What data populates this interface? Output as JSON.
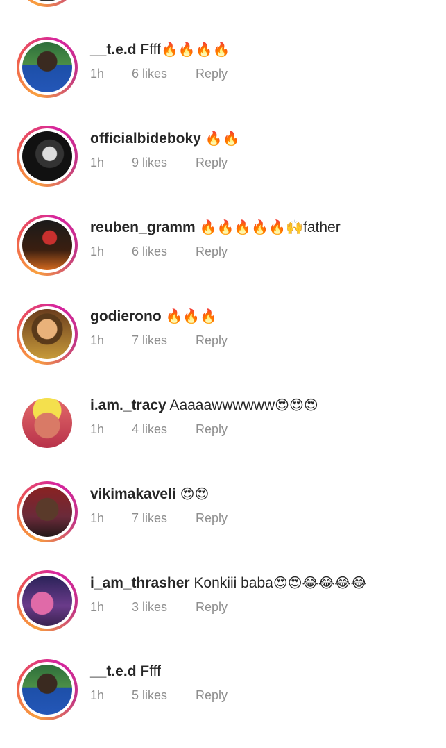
{
  "comments": [
    {
      "username": "__t.e.d",
      "text": "Ffff",
      "emojis": "🔥🔥🔥🔥",
      "time": "1h",
      "likes": "6 likes",
      "reply": "Reply",
      "avatar_icon": "user-avatar-icon",
      "has_story": true
    },
    {
      "username": "officialbideboky",
      "text": "",
      "emojis": "🔥🔥",
      "time": "1h",
      "likes": "9 likes",
      "reply": "Reply",
      "avatar_icon": "user-avatar-icon",
      "has_story": true
    },
    {
      "username": "reuben_gramm",
      "text": "",
      "emojis": "🔥🔥🔥🔥🔥🙌",
      "text_after": "father",
      "time": "1h",
      "likes": "6 likes",
      "reply": "Reply",
      "avatar_icon": "user-avatar-icon",
      "has_story": true
    },
    {
      "username": "godierono",
      "text": "",
      "emojis": "🔥🔥🔥",
      "time": "1h",
      "likes": "7 likes",
      "reply": "Reply",
      "avatar_icon": "user-avatar-icon",
      "has_story": true
    },
    {
      "username": "i.am._tracy",
      "text": "Aaaaawwwwww",
      "emojis": "😍😍😍",
      "time": "1h",
      "likes": "4 likes",
      "reply": "Reply",
      "avatar_icon": "user-avatar-icon",
      "has_story": false
    },
    {
      "username": "vikimakaveli",
      "text": "",
      "emojis": "😍😍",
      "time": "1h",
      "likes": "7 likes",
      "reply": "Reply",
      "avatar_icon": "user-avatar-icon",
      "has_story": true
    },
    {
      "username": "i_am_thrasher",
      "text": "Konkiii baba",
      "emojis": "😍😍😂😂😂😂",
      "time": "1h",
      "likes": "3 likes",
      "reply": "Reply",
      "avatar_icon": "user-avatar-icon",
      "has_story": true
    },
    {
      "username": "__t.e.d",
      "text": "Ffff",
      "emojis": "",
      "time": "1h",
      "likes": "5 likes",
      "reply": "Reply",
      "avatar_icon": "user-avatar-icon",
      "has_story": true
    }
  ],
  "colors": {
    "username": "#262626",
    "meta": "#8e8e8e",
    "story_ring": [
      "#f9a03f",
      "#d6249f",
      "#c13584"
    ]
  }
}
